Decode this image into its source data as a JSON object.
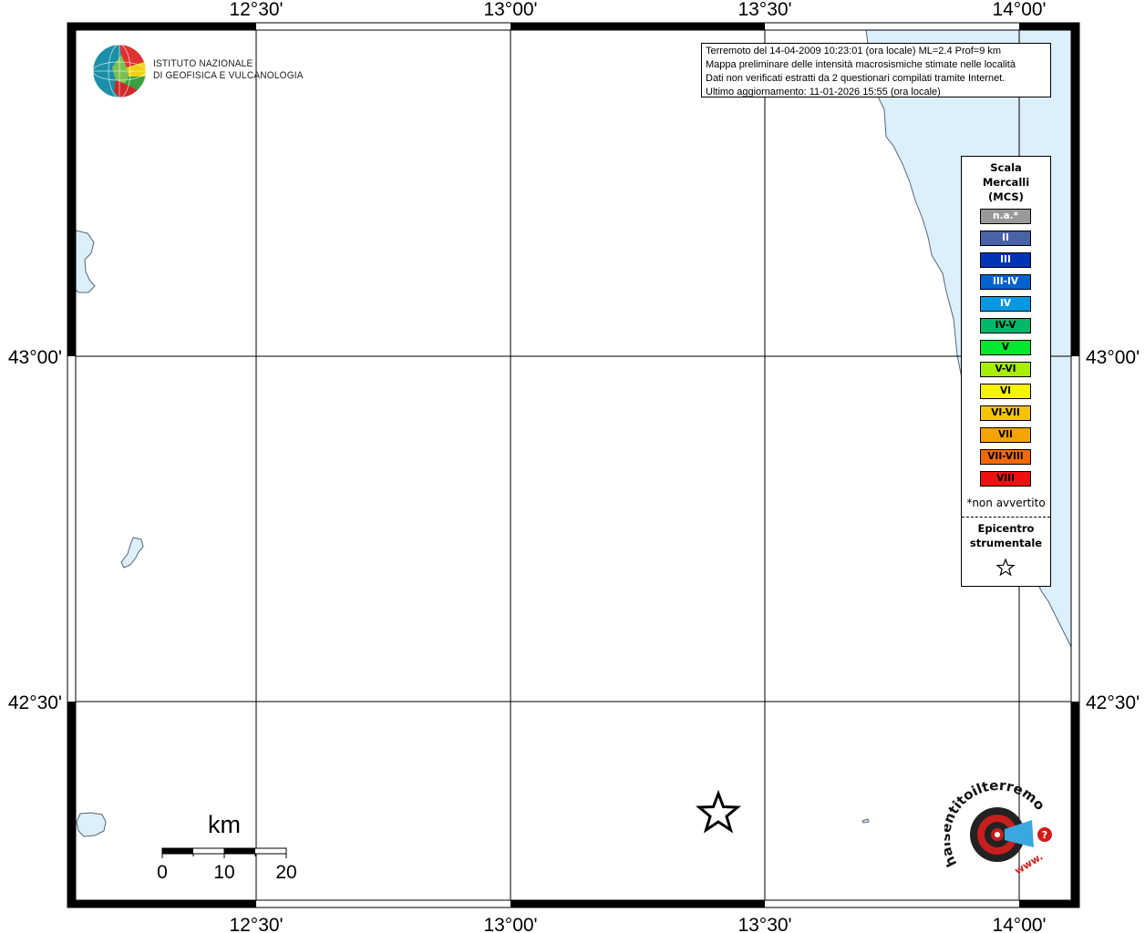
{
  "map": {
    "coordinate_labels": {
      "longitude_top": [
        "12°30'",
        "13°00'",
        "13°30'",
        "14°00'"
      ],
      "longitude_bottom": [
        "12°30'",
        "13°00'",
        "13°30'",
        "14°00'"
      ],
      "latitude_left": [
        "43°00'",
        "42°30'"
      ],
      "latitude_right": [
        "43°00'",
        "42°30'"
      ]
    },
    "colors": {
      "sea": "#ddeffb",
      "coastline": "#556677",
      "grid": "#000000"
    },
    "scale_bar": {
      "unit": "km",
      "ticks": [
        "0",
        "10",
        "20"
      ]
    },
    "epicenter_marker": "star-icon"
  },
  "institute_logo": {
    "line1": "ISTITUTO NAZIONALE",
    "line2": "DI GEOFISICA E VULCANOLOGIA"
  },
  "info": {
    "line1": "Terremoto del 14-04-2009 10:23:01 (ora locale) ML=2.4 Prof=9 km",
    "line2": "Mappa preliminare delle intensità macrosismiche stimate nelle località",
    "line3": "Dati non verificati estratti da 2 questionari compilati tramite Internet.",
    "line4": "Ultimo aggiornamento: 11-01-2026 15:55 (ora locale)"
  },
  "legend": {
    "title_line1": "Scala",
    "title_line2": "Mercalli",
    "title_line3": "(MCS)",
    "items": [
      {
        "label": "n.a.*",
        "color": "#999999",
        "text_color": "#ffffff"
      },
      {
        "label": "II",
        "color": "#4a62a8",
        "text_color": "#ffffff"
      },
      {
        "label": "III",
        "color": "#0033b8",
        "text_color": "#ffffff"
      },
      {
        "label": "III-IV",
        "color": "#0062cf",
        "text_color": "#ffffff"
      },
      {
        "label": "IV",
        "color": "#0099e2",
        "text_color": "#ffffff"
      },
      {
        "label": "IV-V",
        "color": "#00b86a",
        "text_color": "#000000"
      },
      {
        "label": "V",
        "color": "#00e82e",
        "text_color": "#000000"
      },
      {
        "label": "V-VI",
        "color": "#a8f000",
        "text_color": "#000000"
      },
      {
        "label": "VI",
        "color": "#f5f500",
        "text_color": "#000000"
      },
      {
        "label": "VI-VII",
        "color": "#f5c400",
        "text_color": "#000000"
      },
      {
        "label": "VII",
        "color": "#f5a300",
        "text_color": "#000000"
      },
      {
        "label": "VII-VIII",
        "color": "#f56a00",
        "text_color": "#000000"
      },
      {
        "label": "VIII",
        "color": "#f01010",
        "text_color": "#000000"
      }
    ],
    "note": "*non avvertito",
    "epicenter_line1": "Epicentro",
    "epicenter_line2": "strumentale"
  },
  "hsit_logo": {
    "text": "haisentitoilterremoto.it",
    "url_prefix": "www."
  }
}
